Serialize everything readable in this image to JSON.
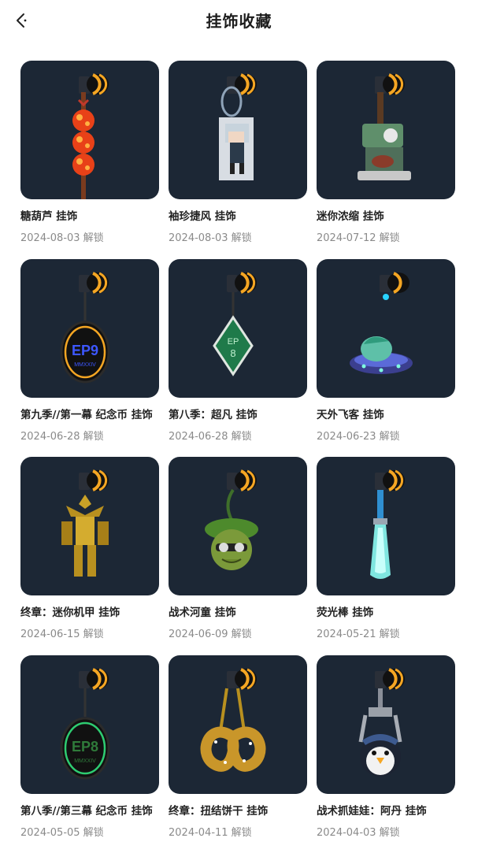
{
  "header": {
    "title": "挂饰收藏",
    "back_icon": "back-chevron-icon"
  },
  "colors": {
    "card_bg": "#1c2735",
    "accent": "#f5a623"
  },
  "items": [
    {
      "name": "糖葫芦 挂饰",
      "date": "2024-08-03 解锁",
      "icon": "candied-haws-charm-icon"
    },
    {
      "name": "袖珍捷风 挂饰",
      "date": "2024-08-03 解锁",
      "icon": "pixel-jett-charm-icon"
    },
    {
      "name": "迷你浓缩 挂饰",
      "date": "2024-07-12 解锁",
      "icon": "mini-espresso-machine-charm-icon"
    },
    {
      "name": "第九季//第一幕 纪念币 挂饰",
      "date": "2024-06-28 解锁",
      "icon": "ep9-coin-charm-icon"
    },
    {
      "name": "第八季：超凡 挂饰",
      "date": "2024-06-28 解锁",
      "icon": "ep8-gem-charm-icon"
    },
    {
      "name": "天外飞客 挂饰",
      "date": "2024-06-23 解锁",
      "icon": "ufo-charm-icon"
    },
    {
      "name": "终章：迷你机甲 挂饰",
      "date": "2024-06-15 解锁",
      "icon": "mini-mech-charm-icon"
    },
    {
      "name": "战术河童 挂饰",
      "date": "2024-06-09 解锁",
      "icon": "kappa-charm-icon"
    },
    {
      "name": "荧光棒 挂饰",
      "date": "2024-05-21 解锁",
      "icon": "glowstick-charm-icon"
    },
    {
      "name": "第八季//第三幕 纪念币 挂饰",
      "date": "2024-05-05 解锁",
      "icon": "ep8-coin-charm-icon"
    },
    {
      "name": "终章：扭结饼干 挂饰",
      "date": "2024-04-11 解锁",
      "icon": "pretzel-charm-icon"
    },
    {
      "name": "战术抓娃娃：阿丹 挂饰",
      "date": "2024-04-03 解锁",
      "icon": "claw-penguin-charm-icon"
    }
  ],
  "coin_texts": {
    "ep9": "EP9",
    "ep8": "EP8",
    "ep8_gem": "EP",
    "ep8_gem_num": "8",
    "mmxxiv": "MMXXIV"
  }
}
